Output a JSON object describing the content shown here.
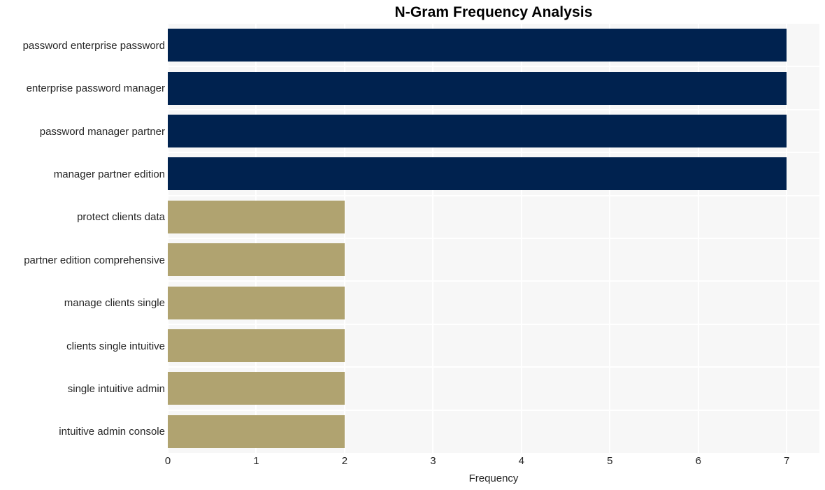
{
  "chart_data": {
    "type": "bar",
    "orientation": "horizontal",
    "title": "N-Gram Frequency Analysis",
    "xlabel": "Frequency",
    "ylabel": "",
    "categories": [
      "password enterprise password",
      "enterprise password manager",
      "password manager partner",
      "manager partner edition",
      "protect clients data",
      "partner edition comprehensive",
      "manage clients single",
      "clients single intuitive",
      "single intuitive admin",
      "intuitive admin console"
    ],
    "values": [
      7,
      7,
      7,
      7,
      2,
      2,
      2,
      2,
      2,
      2
    ],
    "bar_colors": [
      "#00224f",
      "#00224f",
      "#00224f",
      "#00224f",
      "#b0a370",
      "#b0a370",
      "#b0a370",
      "#b0a370",
      "#b0a370",
      "#b0a370"
    ],
    "xlim": [
      0,
      7.37
    ],
    "xticks": [
      0,
      1,
      2,
      3,
      4,
      5,
      6,
      7
    ],
    "xtick_labels": [
      "0",
      "1",
      "2",
      "3",
      "4",
      "5",
      "6",
      "7"
    ],
    "grid": true,
    "grid_color": "#ffffff",
    "plot_background": "#f7f7f7",
    "figure_background": "#ffffff",
    "legend": null,
    "legend_position": "none"
  }
}
